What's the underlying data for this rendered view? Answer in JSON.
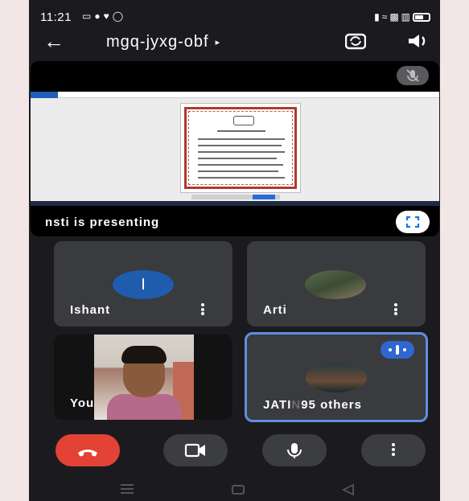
{
  "status_bar": {
    "time": "11:21",
    "notification_icons": [
      "cast-icon",
      "chat-icon",
      "heart-icon",
      "whatsapp-icon"
    ],
    "system_icons": [
      "vibrate-icon",
      "wifi-icon",
      "volte-icon",
      "signal-icon",
      "battery-icon"
    ]
  },
  "header": {
    "back_icon": "back-arrow-icon",
    "title": "mgq-jyxg-obf",
    "title_caret": "▸",
    "actions": [
      "switch-camera-icon",
      "speaker-icon"
    ]
  },
  "presentation": {
    "label": "nsti is presenting",
    "mic_state": "muted",
    "fullscreen_icon": "fullscreen-icon"
  },
  "participants": [
    {
      "name": "Ishant",
      "initial": "I",
      "avatar_color": "#1f5cad"
    },
    {
      "name": "Arti",
      "avatar": "photo"
    },
    {
      "name": "You",
      "video": "on"
    }
  ],
  "others_tile": {
    "name_visible": "JATI",
    "name_faded": "N",
    "count_label": "95 others",
    "speaking_indicator": "speaking-icon"
  },
  "controls": [
    {
      "name": "end-call",
      "icon": "hang-up-icon",
      "color": "#e34234"
    },
    {
      "name": "camera",
      "icon": "camera-icon"
    },
    {
      "name": "microphone",
      "icon": "microphone-icon"
    },
    {
      "name": "more-options",
      "icon": "more-vert-icon"
    }
  ],
  "colors": {
    "background": "#1b1b1f",
    "tile": "#3a3b3e",
    "accent": "#5f8fe0",
    "hangup": "#e34234"
  }
}
